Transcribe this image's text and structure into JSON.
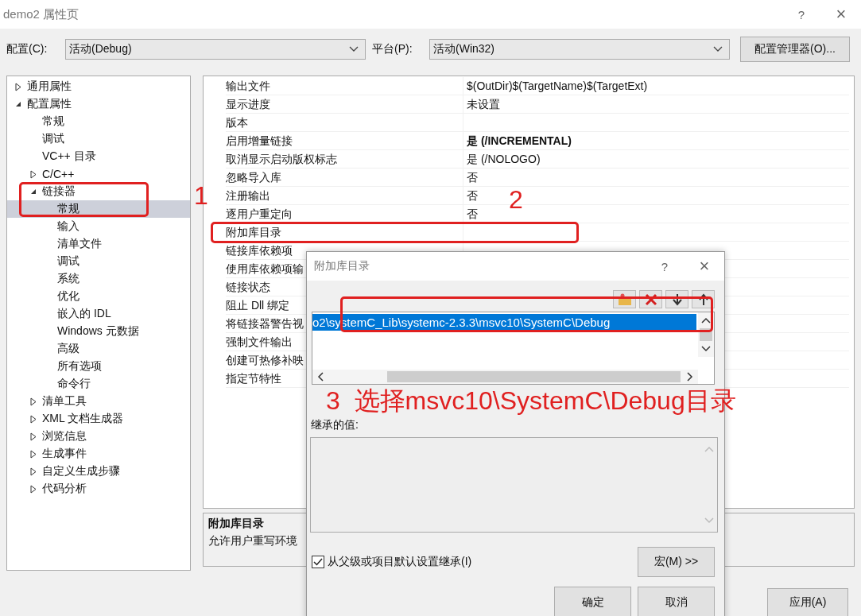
{
  "window": {
    "title": "demo2 属性页",
    "help": "?",
    "close": "×"
  },
  "config": {
    "label": "配置(C):",
    "value": "活动(Debug)"
  },
  "platform": {
    "label": "平台(P):",
    "value": "活动(Win32)"
  },
  "config_manager_button": "配置管理器(O)...",
  "tree": [
    {
      "label": "通用属性",
      "expanded": false,
      "selected": false
    },
    {
      "label": "配置属性",
      "expanded": true,
      "selected": false,
      "children": [
        {
          "label": "常规",
          "selected": false
        },
        {
          "label": "调试",
          "selected": false
        },
        {
          "label": "VC++ 目录",
          "selected": false
        },
        {
          "label": "C/C++",
          "expanded": false,
          "selected": false
        },
        {
          "label": "链接器",
          "expanded": true,
          "selected": false,
          "children": [
            {
              "label": "常规",
              "selected": true
            },
            {
              "label": "输入",
              "selected": false
            },
            {
              "label": "清单文件",
              "selected": false
            },
            {
              "label": "调试",
              "selected": false
            },
            {
              "label": "系统",
              "selected": false
            },
            {
              "label": "优化",
              "selected": false
            },
            {
              "label": "嵌入的 IDL",
              "selected": false
            },
            {
              "label": "Windows 元数据",
              "selected": false
            },
            {
              "label": "高级",
              "selected": false
            },
            {
              "label": "所有选项",
              "selected": false
            },
            {
              "label": "命令行",
              "selected": false
            }
          ]
        },
        {
          "label": "清单工具",
          "expanded": false,
          "selected": false
        },
        {
          "label": "XML 文档生成器",
          "expanded": false,
          "selected": false
        },
        {
          "label": "浏览信息",
          "expanded": false,
          "selected": false
        },
        {
          "label": "生成事件",
          "expanded": false,
          "selected": false
        },
        {
          "label": "自定义生成步骤",
          "expanded": false,
          "selected": false
        },
        {
          "label": "代码分析",
          "expanded": false,
          "selected": false
        }
      ]
    }
  ],
  "properties": [
    {
      "name": "输出文件",
      "value": "$(OutDir)$(TargetName)$(TargetExt)",
      "bold": false
    },
    {
      "name": "显示进度",
      "value": "未设置",
      "bold": false
    },
    {
      "name": "版本"
    },
    {
      "name": "启用增量链接",
      "value": "是 (/INCREMENTAL)",
      "bold": true
    },
    {
      "name": "取消显示启动版权标志",
      "value": "是 (/NOLOGO)",
      "bold": false
    },
    {
      "name": "忽略导入库",
      "value": "否",
      "bold": false
    },
    {
      "name": "注册输出",
      "value": "否",
      "bold": false
    },
    {
      "name": "逐用户重定向",
      "value": "否",
      "bold": false
    },
    {
      "name": "附加库目录"
    },
    {
      "name": "链接库依赖项"
    },
    {
      "name": "使用库依赖项输"
    },
    {
      "name": "链接状态"
    },
    {
      "name": "阻止 Dll 绑定"
    },
    {
      "name": "将链接器警告视"
    },
    {
      "name": "强制文件输出"
    },
    {
      "name": "创建可热修补映"
    },
    {
      "name": "指定节特性"
    }
  ],
  "description": {
    "title": "附加库目录",
    "text": "允许用户重写环境"
  },
  "apply_button": "应用(A)",
  "dialog": {
    "title": "附加库目录",
    "help": "?",
    "close": "×",
    "entries": [
      {
        "text": "o2\\systemC_Lib\\systemc-2.3.3\\msvc10\\SystemC\\Debug",
        "selected": true
      }
    ],
    "inherited_label": "继承的值:",
    "inherit_checkbox": {
      "label": "从父级或项目默认设置继承(I)",
      "checked": true
    },
    "macros_button": "宏(M) >>",
    "ok_button": "确定",
    "cancel_button": "取消"
  },
  "annotations": [
    {
      "label": "1"
    },
    {
      "label": "2"
    },
    {
      "label": "3  选择msvc10\\SystemC\\Debug目录"
    }
  ]
}
